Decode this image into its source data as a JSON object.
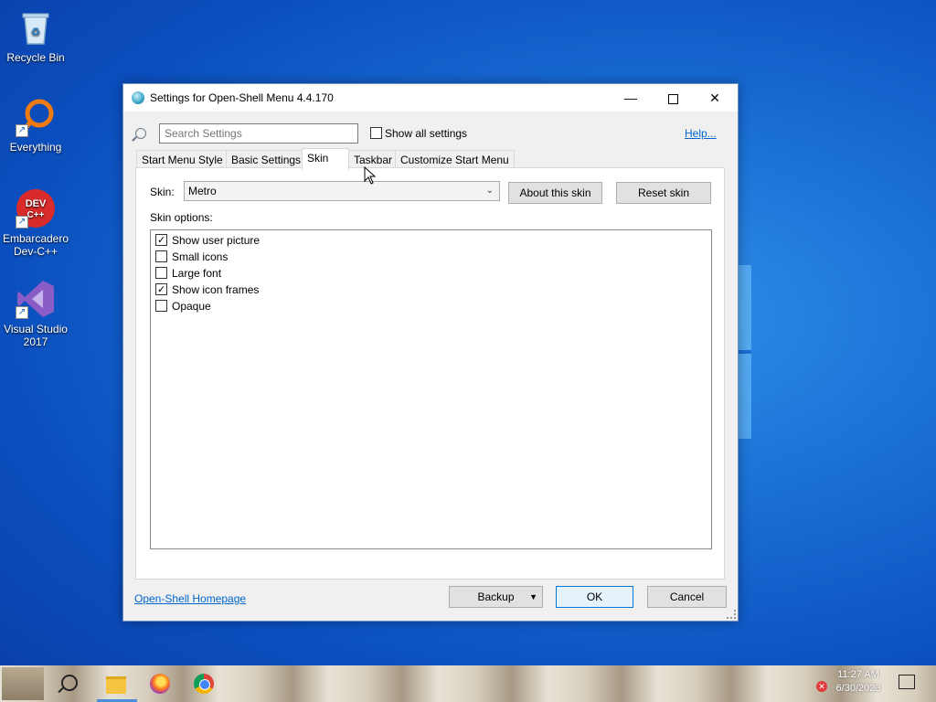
{
  "desktop": {
    "icons": [
      {
        "label": "Recycle Bin"
      },
      {
        "label": "Everything"
      },
      {
        "label": "Embarcadero Dev-C++"
      },
      {
        "label": "Visual Studio 2017"
      }
    ],
    "devcpp_logo_text": "DEV C++"
  },
  "window": {
    "title": "Settings for Open-Shell Menu 4.4.170",
    "search_placeholder": "Search Settings",
    "show_all_label": "Show all settings",
    "help_label": "Help...",
    "tabs": [
      {
        "label": "Start Menu Style"
      },
      {
        "label": "Basic Settings"
      },
      {
        "label": "Skin"
      },
      {
        "label": "Taskbar"
      },
      {
        "label": "Customize Start Menu"
      }
    ],
    "active_tab": "Skin",
    "skin_label": "Skin:",
    "skin_value": "Metro",
    "about_skin_label": "About this skin",
    "reset_skin_label": "Reset skin",
    "skin_options_label": "Skin options:",
    "options": [
      {
        "label": "Show user picture",
        "checked": true
      },
      {
        "label": "Small icons",
        "checked": false
      },
      {
        "label": "Large font",
        "checked": false
      },
      {
        "label": "Show icon frames",
        "checked": true
      },
      {
        "label": "Opaque",
        "checked": false
      }
    ],
    "homepage_label": "Open-Shell Homepage",
    "backup_label": "Backup",
    "ok_label": "OK",
    "cancel_label": "Cancel"
  },
  "taskbar": {
    "time": "11:27 AM",
    "date": "6/30/2023"
  }
}
